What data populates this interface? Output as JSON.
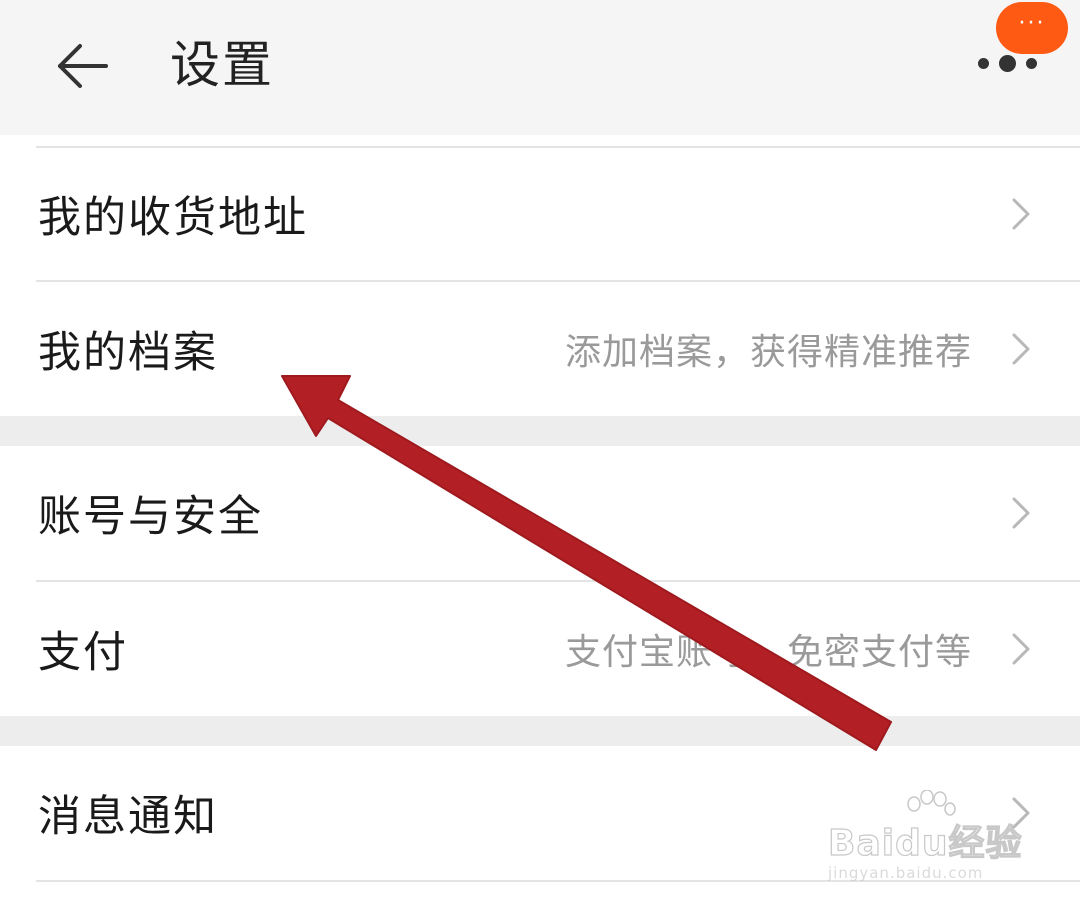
{
  "header": {
    "title": "设置",
    "back_icon": "arrow-left-icon",
    "more_icon": "more-dots-icon",
    "badge_text": "···"
  },
  "items": [
    {
      "label": "我的收货地址",
      "hint": "",
      "icon": "chevron-right-icon"
    },
    {
      "label": "我的档案",
      "hint": "添加档案，获得精准推荐",
      "icon": "chevron-right-icon"
    },
    {
      "label": "账号与安全",
      "hint": "",
      "icon": "chevron-right-icon"
    },
    {
      "label": "支付",
      "hint": "支付宝账号、免密支付等",
      "icon": "chevron-right-icon"
    },
    {
      "label": "消息通知",
      "hint": "",
      "icon": "chevron-right-icon"
    }
  ],
  "watermark": {
    "brand": "Baidu经验",
    "url": "jingyan.baidu.com"
  },
  "colors": {
    "accent_badge": "#ff5a14",
    "annotation_arrow": "#b21f24",
    "header_bg": "#f5f5f5",
    "section_gap": "#ededed"
  }
}
